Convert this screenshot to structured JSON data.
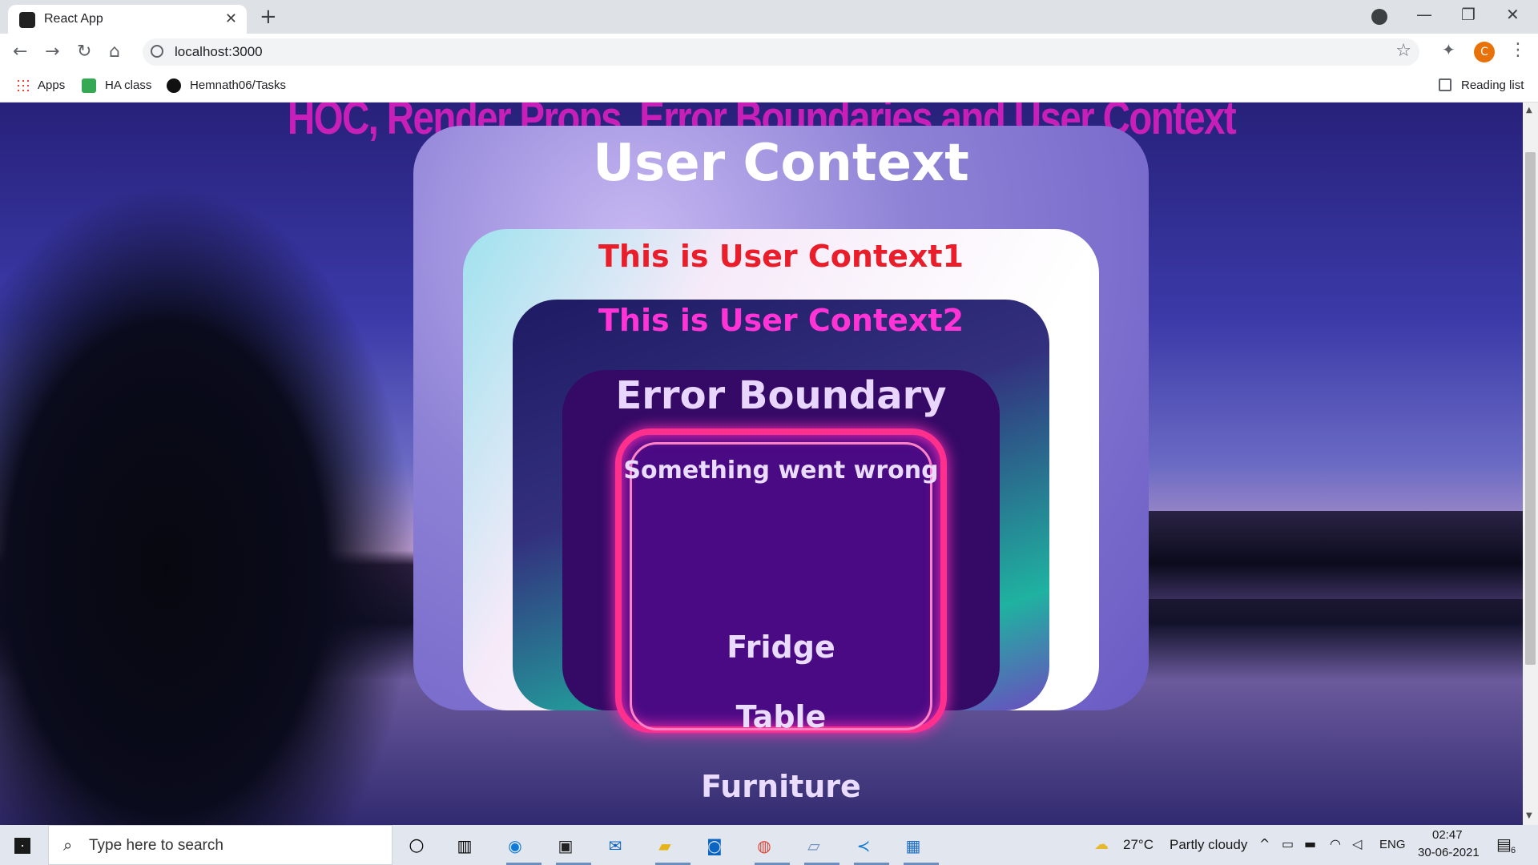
{
  "browser": {
    "tab_title": "React App",
    "url": "localhost:3000",
    "bookmarks": [
      "Apps",
      "HA class",
      "Hemnath06/Tasks"
    ],
    "reading_list": "Reading list",
    "profile_initial": "C"
  },
  "page": {
    "title": "HOC, Render Props, Error Boundaries and User Context",
    "outer_panel_title": "User Context",
    "context1_title": "This is User Context1",
    "context2_title": "This is User Context2",
    "error_boundary_title": "Error Boundary",
    "error_message": "Something went wrong",
    "items": [
      "Fridge",
      "Table",
      "Furniture"
    ]
  },
  "taskbar": {
    "search_placeholder": "Type here to search",
    "weather_temp": "27°C",
    "weather_desc": "Partly cloudy",
    "language": "ENG",
    "time": "02:47",
    "date": "30-06-2021",
    "notification_count": "6"
  }
}
